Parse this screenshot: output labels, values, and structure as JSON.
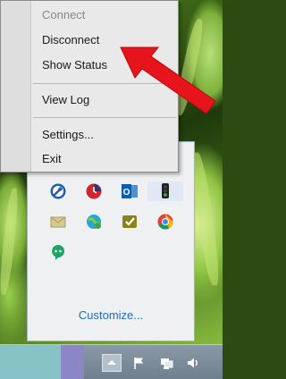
{
  "context_menu": {
    "items": [
      {
        "label": "Connect",
        "enabled": false
      },
      {
        "label": "Disconnect",
        "enabled": true
      },
      {
        "label": "Show Status",
        "enabled": true
      },
      {
        "label": "View Log",
        "enabled": true
      },
      {
        "label": "Settings...",
        "enabled": true
      },
      {
        "label": "Exit",
        "enabled": true
      }
    ]
  },
  "tray_panel": {
    "customize_label": "Customize...",
    "icons": [
      "tool-icon",
      "clock-icon",
      "outlook-icon",
      "traffic-light-icon",
      "mail-icon",
      "globe-icon",
      "check-icon",
      "chrome-icon",
      "chat-icon"
    ]
  },
  "taskbar": {
    "icons": [
      "show-hidden-icons-chevron-icon",
      "action-center-flag-icon",
      "network-icon",
      "volume-icon"
    ]
  },
  "colors": {
    "annotation_arrow": "#e8141b",
    "link": "#1e6fbf",
    "menu_background": "#e9e9e9"
  }
}
